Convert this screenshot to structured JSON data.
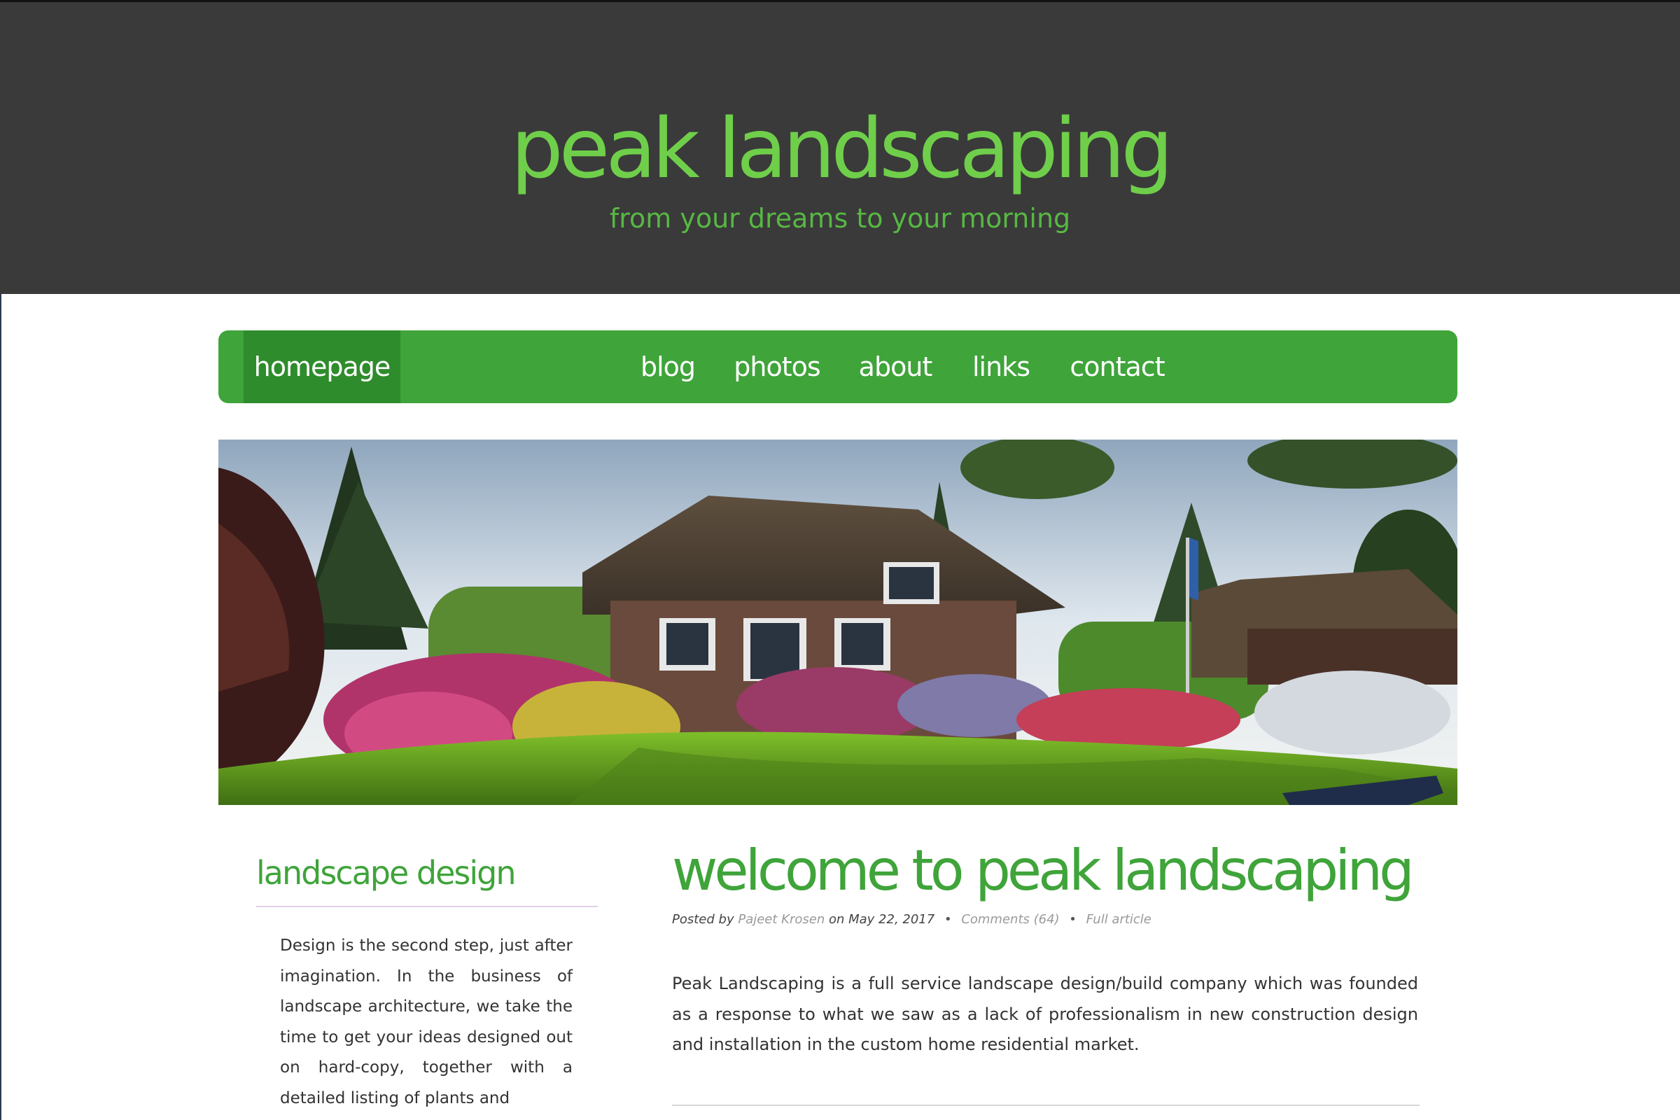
{
  "site": {
    "title": "peak landscaping",
    "tagline": "from your dreams to your morning"
  },
  "nav": {
    "items": [
      {
        "label": "homepage",
        "active": true
      },
      {
        "label": "blog",
        "active": false
      },
      {
        "label": "photos",
        "active": false
      },
      {
        "label": "about",
        "active": false
      },
      {
        "label": "links",
        "active": false
      },
      {
        "label": "contact",
        "active": false
      }
    ]
  },
  "hero": {
    "image": "house-garden-photo"
  },
  "sidebar": {
    "title": "landscape design",
    "text": "Design is the second step, just after imagination. In the business of landscape architecture, we take the time to get your ideas designed out on hard-copy, together with a detailed listing of plants and"
  },
  "article": {
    "title": "welcome to peak landscaping",
    "meta": {
      "posted_by_label": "Posted by",
      "author": "Pajeet Krosen",
      "on_label": "on",
      "date": "May 22, 2017",
      "comments": "Comments (64)",
      "full_article": "Full article",
      "separator": "•"
    },
    "body": "Peak Landscaping is a full service landscape design/build company which was founded as a response to what we saw as a lack of professionalism in new construction design and installation in the custom home residential market."
  },
  "colors": {
    "header_bg": "#3a3a3a",
    "brand_green": "#6fcf4a",
    "nav_green": "#3fa43a",
    "nav_active": "#2f8c2c"
  }
}
